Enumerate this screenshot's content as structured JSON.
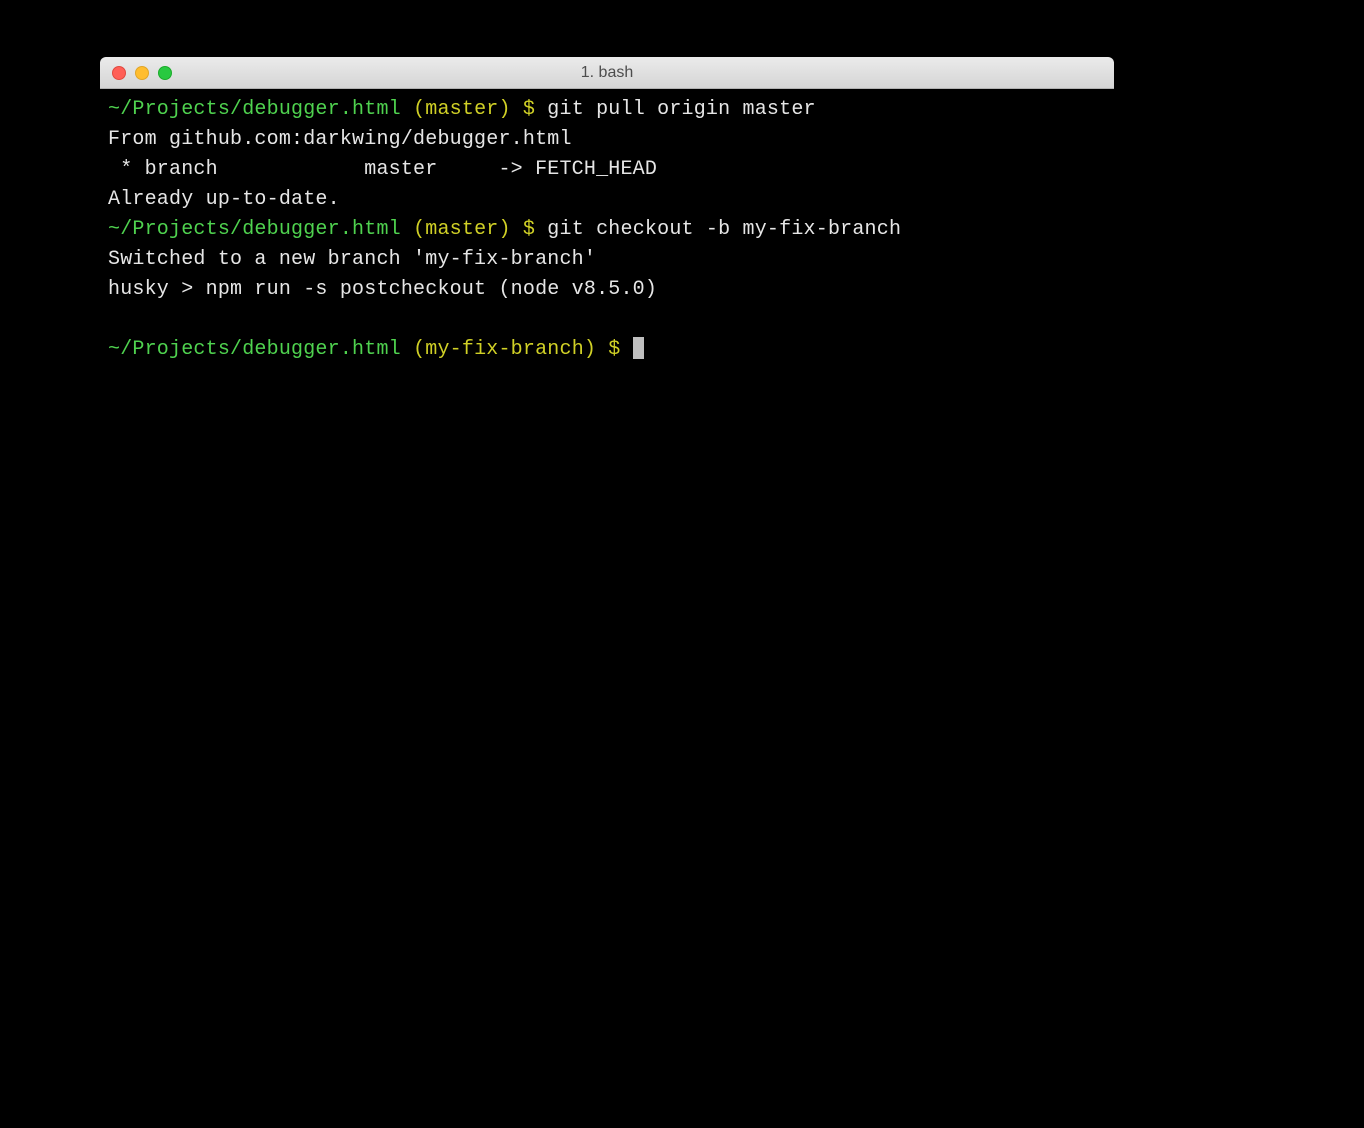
{
  "window": {
    "title": "1. bash"
  },
  "colors": {
    "path": "#4fd24f",
    "branch": "#d0d026",
    "text": "#e6e6e6",
    "bg": "#000000"
  },
  "lines": [
    {
      "path": "~/Projects/debugger.html",
      "branch": "(master)",
      "dollar": "$",
      "cmd": "git pull origin master"
    },
    {
      "out": "From github.com:darkwing/debugger.html"
    },
    {
      "out": " * branch            master     -> FETCH_HEAD"
    },
    {
      "out": "Already up-to-date."
    },
    {
      "path": "~/Projects/debugger.html",
      "branch": "(master)",
      "dollar": "$",
      "cmd": "git checkout -b my-fix-branch"
    },
    {
      "out": "Switched to a new branch 'my-fix-branch'"
    },
    {
      "out": "husky > npm run -s postcheckout (node v8.5.0)"
    },
    {
      "blank": true
    },
    {
      "path": "~/Projects/debugger.html",
      "branch": "(my-fix-branch)",
      "dollar": "$",
      "cursor": true
    }
  ]
}
